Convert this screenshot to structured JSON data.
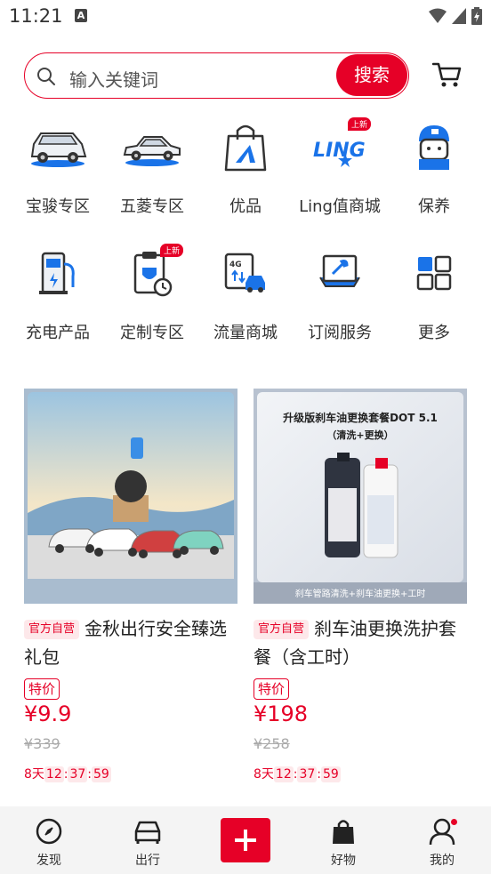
{
  "status": {
    "time": "11:21",
    "a_glyph": "A"
  },
  "search": {
    "placeholder": "输入关键词",
    "button": "搜索"
  },
  "categories": [
    {
      "label": "宝骏专区",
      "icon": "suv-car-icon"
    },
    {
      "label": "五菱专区",
      "icon": "sedan-car-icon"
    },
    {
      "label": "优品",
      "icon": "shopping-bag-icon"
    },
    {
      "label": "Ling值商城",
      "icon": "ling-logo-icon",
      "badge": "上新"
    },
    {
      "label": "保养",
      "icon": "mechanic-icon"
    },
    {
      "label": "充电产品",
      "icon": "charging-pile-icon"
    },
    {
      "label": "定制专区",
      "icon": "custom-clipboard-icon",
      "badge": "上新"
    },
    {
      "label": "流量商城",
      "icon": "4g-data-icon"
    },
    {
      "label": "订阅服务",
      "icon": "subscription-tool-icon"
    },
    {
      "label": "更多",
      "icon": "more-grid-icon"
    }
  ],
  "products": [
    {
      "tag": "官方自营",
      "title": "金秋出行安全臻选礼包",
      "special": "特价",
      "price": "¥9.9",
      "original": "¥339",
      "countdown_days": "8天",
      "countdown_h": "12",
      "countdown_m": "37",
      "countdown_s": "59"
    },
    {
      "tag": "官方自营",
      "title": "刹车油更换洗护套餐（含工时）",
      "special": "特价",
      "price": "¥198",
      "original": "¥258",
      "countdown_days": "8天",
      "countdown_h": "12",
      "countdown_m": "37",
      "countdown_s": "59",
      "image_headline": "升级版刹车油更换套餐DOT 5.1",
      "image_subline": "（清洗+更换）",
      "image_footer": "刹车管路清洗+刹车油更换+工时"
    }
  ],
  "tabbar": [
    {
      "label": "发现",
      "icon": "compass-icon"
    },
    {
      "label": "出行",
      "icon": "car-front-icon"
    },
    {
      "label": "",
      "icon": "plus-icon"
    },
    {
      "label": "好物",
      "icon": "bag-icon"
    },
    {
      "label": "我的",
      "icon": "user-icon"
    }
  ],
  "colors": {
    "accent": "#e60027",
    "brand_blue": "#1a73e8"
  }
}
